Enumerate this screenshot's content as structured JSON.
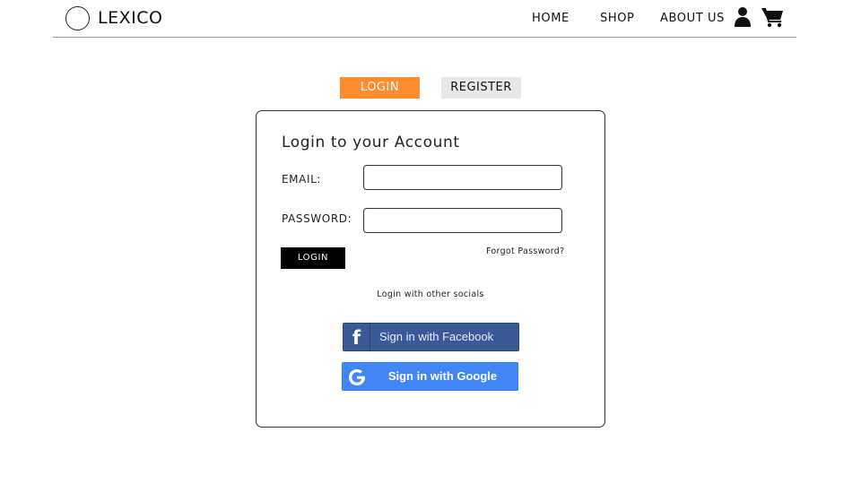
{
  "brand": {
    "name": "LEXICO"
  },
  "nav": {
    "home": "HOME",
    "shop": "SHOP",
    "about": "ABOUT US",
    "icons": [
      "user-icon",
      "cart-icon"
    ]
  },
  "tabs": {
    "login": "LOGIN",
    "register": "REGISTER"
  },
  "form": {
    "title": "Login to your Account",
    "email_label": "EMAIL:",
    "email_value": "",
    "password_label": "PASSWORD:",
    "password_value": "",
    "login_button": "LOGIN",
    "forgot": "Forgot Password?",
    "socials_text": "Login with other socials",
    "facebook_button": "Sign in with Facebook",
    "google_button": "Sign in with Google"
  },
  "colors": {
    "accent": "#ff8c2e",
    "facebook": "#3b5998",
    "google": "#4285f4"
  }
}
